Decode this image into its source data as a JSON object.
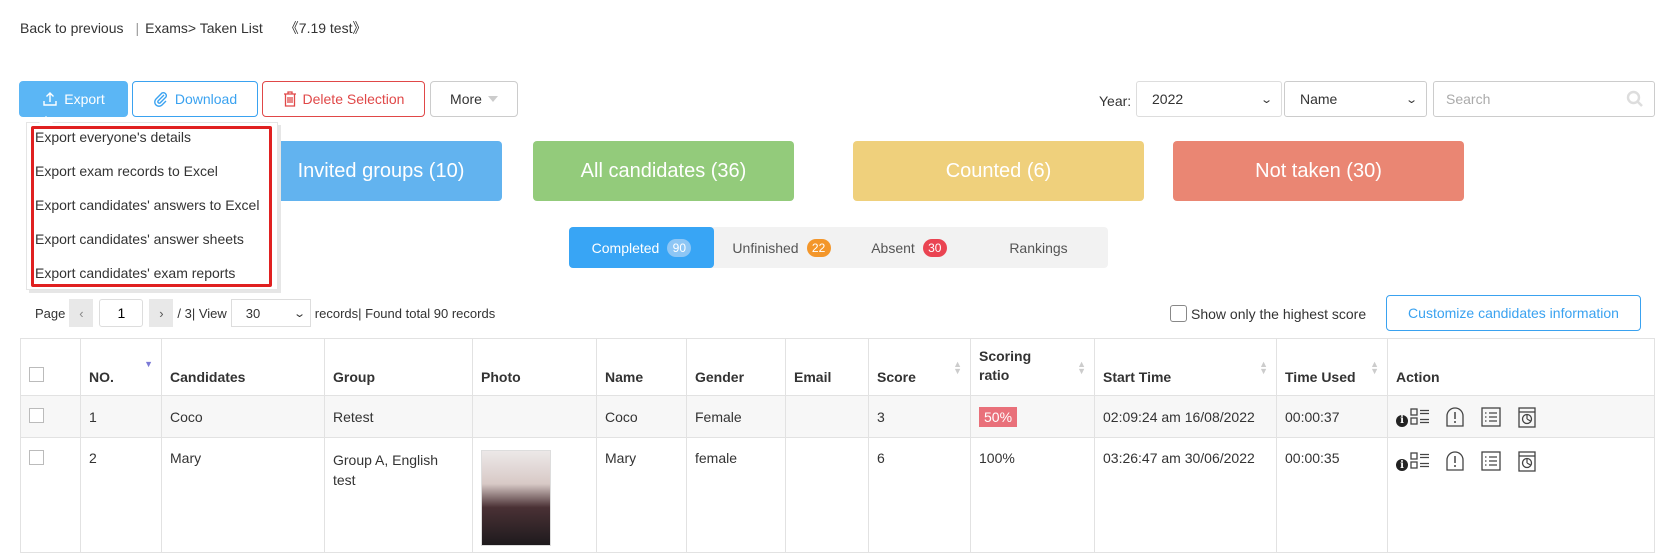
{
  "breadcrumb": {
    "back": "Back to previous",
    "separator": "|",
    "path": "Exams> Taken List",
    "exam_name": "《7.19 test》"
  },
  "toolbar": {
    "export_label": "Export",
    "download_label": "Download",
    "delete_label": "Delete Selection",
    "more_label": "More"
  },
  "export_menu": {
    "items": [
      "Export everyone's details",
      "Export exam records to Excel",
      "Export candidates' answers to Excel",
      "Export candidates' answer sheets",
      "Export candidates' exam reports"
    ]
  },
  "filters": {
    "year_label": "Year:",
    "year_value": "2022",
    "field_value": "Name",
    "search_placeholder": "Search"
  },
  "stats": {
    "invited": "Invited groups (10)",
    "all": "All candidates (36)",
    "counted": "Counted (6)",
    "not_taken": "Not taken (30)"
  },
  "tabs": [
    {
      "label": "Completed",
      "count": "90",
      "active": true
    },
    {
      "label": "Unfinished",
      "count": "22"
    },
    {
      "label": "Absent",
      "count": "30"
    },
    {
      "label": "Rankings"
    }
  ],
  "pager": {
    "page_label": "Page",
    "current_page": "1",
    "total_pages": "/ 3",
    "view_label": "| View",
    "per_page": "30",
    "records_label": "records",
    "found_label": "| Found total 90 records"
  },
  "options": {
    "highest_only_label": "Show only the highest score",
    "customize_label": "Customize candidates information"
  },
  "table": {
    "columns": [
      "NO.",
      "Candidates",
      "Group",
      "Photo",
      "Name",
      "Gender",
      "Email",
      "Score",
      "Scoring ratio",
      "Start Time",
      "Time Used",
      "Action"
    ],
    "rows": [
      {
        "no": "1",
        "candidate": "Coco",
        "group": "Retest",
        "name": "Coco",
        "gender": "Female",
        "email": "",
        "score": "3",
        "ratio": "50%",
        "start": "02:09:24 am 16/08/2022",
        "used": "00:00:37"
      },
      {
        "no": "2",
        "candidate": "Mary",
        "group": "Group A, English test",
        "name": "Mary",
        "gender": "female",
        "email": "",
        "score": "6",
        "ratio": "100%",
        "start": "03:26:47 am 30/06/2022",
        "used": "00:00:35"
      }
    ]
  },
  "colors": {
    "primary": "#38a5f5",
    "danger": "#e04848",
    "card_invited": "#62b3ef",
    "card_all": "#93cb7b",
    "card_counted": "#efd07c",
    "card_not_taken": "#ea8673",
    "highlight_frame": "#e02020"
  }
}
